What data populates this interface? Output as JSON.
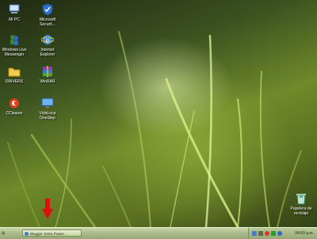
{
  "desktop": {
    "icons": [
      {
        "label": "Mi PC",
        "icon": "my-computer-icon"
      },
      {
        "label": "Microsoft Securit...",
        "icon": "security-shield-icon"
      },
      {
        "label": "Windows Live Messenger",
        "icon": "messenger-icon"
      },
      {
        "label": "Internet Explorer",
        "icon": "internet-explorer-icon"
      },
      {
        "label": "DRIVERS",
        "icon": "folder-icon"
      },
      {
        "label": "WinRAR",
        "icon": "winrar-icon"
      },
      {
        "label": "CCleaner",
        "icon": "ccleaner-icon"
      },
      {
        "label": "VidaLoca OneStep",
        "icon": "monitor-icon"
      },
      {
        "label": "Papelera de reciclaje",
        "icon": "recycle-bin-icon"
      }
    ]
  },
  "taskbar": {
    "start_label": "⊞",
    "task_button_label": "Blogger: Extra Power...",
    "clock": "04:59 a.m."
  },
  "colors": {
    "taskbar": "#a9b98a",
    "arrow": "#e01010"
  }
}
